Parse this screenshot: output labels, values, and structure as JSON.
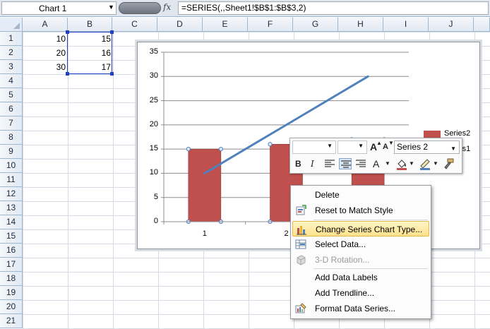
{
  "formula_bar": {
    "name_box": "Chart 1",
    "fx_label": "fx",
    "formula": "=SERIES(,,Sheet1!$B$1:$B$3,2)"
  },
  "columns": [
    "A",
    "B",
    "C",
    "D",
    "E",
    "F",
    "G",
    "H",
    "I",
    "J"
  ],
  "rows": [
    "1",
    "2",
    "3",
    "4",
    "5",
    "6",
    "7",
    "8",
    "9",
    "10",
    "11",
    "12",
    "13",
    "14",
    "15",
    "16",
    "17",
    "18",
    "19",
    "20",
    "21"
  ],
  "cells": {
    "A1": "10",
    "B1": "15",
    "A2": "20",
    "B2": "16",
    "A3": "30",
    "B3": "17"
  },
  "chart_data": {
    "type": "bar",
    "categories": [
      "1",
      "2",
      "3"
    ],
    "series": [
      {
        "name": "Series2",
        "type": "bar",
        "values": [
          15,
          16,
          17
        ],
        "color": "#c0504d"
      },
      {
        "name": "Series1",
        "type": "line",
        "values": [
          10,
          20,
          30
        ],
        "color": "#4f81bd"
      }
    ],
    "yticks": [
      "0",
      "5",
      "10",
      "15",
      "20",
      "25",
      "30",
      "35"
    ],
    "ylim": [
      0,
      35
    ],
    "grid": true,
    "legend": "right"
  },
  "mini_toolbar": {
    "series_select": "Series 2",
    "grow_font": "A",
    "shrink_font": "A",
    "bold": "B",
    "italic": "I",
    "font_color": "A"
  },
  "context_menu": {
    "items": [
      {
        "label": "Delete",
        "enabled": true
      },
      {
        "label": "Reset to Match Style",
        "enabled": true
      },
      {
        "label": "Change Series Chart Type...",
        "enabled": true,
        "highlighted": true
      },
      {
        "label": "Select Data...",
        "enabled": true
      },
      {
        "label": "3-D Rotation...",
        "enabled": false
      },
      {
        "label": "Add Data Labels",
        "enabled": true
      },
      {
        "label": "Add Trendline...",
        "enabled": true
      },
      {
        "label": "Format Data Series...",
        "enabled": true
      }
    ]
  },
  "colors": {
    "bar": "#c0504d",
    "line": "#4f81bd",
    "selection": "#2040c8"
  }
}
